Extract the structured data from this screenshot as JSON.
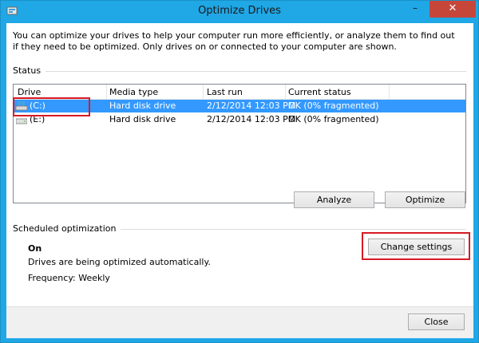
{
  "window": {
    "title": "Optimize Drives",
    "minimize_glyph": "–",
    "close_glyph": "✕"
  },
  "intro_text": "You can optimize your drives to help your computer run more efficiently, or analyze them to find out if they need to be optimized. Only drives on or connected to your computer are shown.",
  "status": {
    "label": "Status",
    "columns": [
      "Drive",
      "Media type",
      "Last run",
      "Current status"
    ],
    "rows": [
      {
        "drive": "(C:)",
        "media": "Hard disk drive",
        "last_run": "2/12/2014 12:03 PM",
        "status": "OK (0% fragmented)",
        "icon": "windows-drive-icon",
        "selected": true
      },
      {
        "drive": "(E:)",
        "media": "Hard disk drive",
        "last_run": "2/12/2014 12:03 PM",
        "status": "OK (0% fragmented)",
        "icon": "hard-drive-icon",
        "selected": false
      }
    ],
    "analyze_label": "Analyze",
    "optimize_label": "Optimize"
  },
  "schedule": {
    "label": "Scheduled optimization",
    "state": "On",
    "description": "Drives are being optimized automatically.",
    "frequency": "Frequency: Weekly",
    "change_label": "Change settings"
  },
  "footer": {
    "close_label": "Close"
  },
  "colors": {
    "title_bar": "#1fa7e6",
    "close_button": "#c7463a",
    "selection": "#3399ff",
    "highlight": "#d71a24"
  }
}
